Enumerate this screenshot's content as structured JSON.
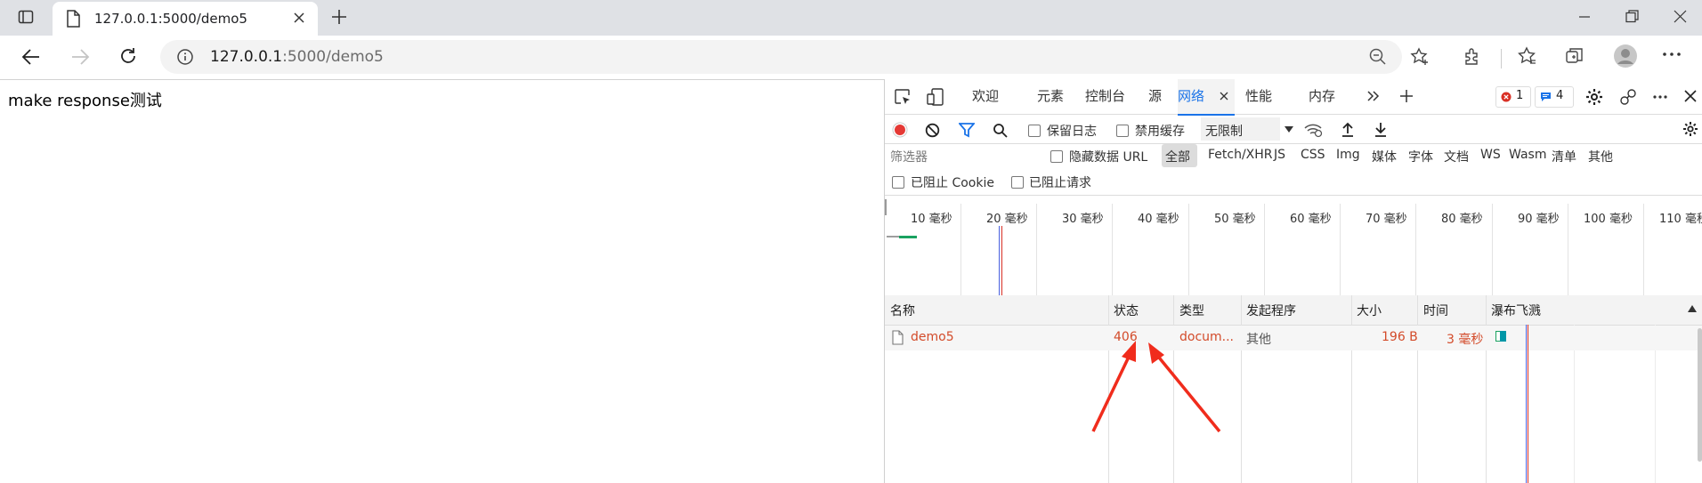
{
  "browser": {
    "tab_title": "127.0.0.1:5000/demo5",
    "url_host": "127.0.0.1",
    "url_path": ":5000/demo5"
  },
  "page": {
    "text": "make response测试"
  },
  "devtools": {
    "tabs": [
      "欢迎",
      "元素",
      "控制台",
      "源",
      "网络",
      "性能",
      "内存"
    ],
    "active_tab": "网络",
    "error_count": "1",
    "message_count": "4",
    "toolbar": {
      "preserve_log": "保留日志",
      "disable_cache": "禁用缓存",
      "throttle": "无限制"
    },
    "filter": {
      "placeholder": "筛选器",
      "hide_data_url": "隐藏数据 URL",
      "types": [
        "全部",
        "Fetch/XHR",
        "JS",
        "CSS",
        "Img",
        "媒体",
        "字体",
        "文档",
        "WS",
        "Wasm",
        "清单",
        "其他"
      ],
      "blocked_cookies": "已阻止 Cookie",
      "blocked_requests": "已阻止请求"
    },
    "timeline_ticks": [
      "10 毫秒",
      "20 毫秒",
      "30 毫秒",
      "40 毫秒",
      "50 毫秒",
      "60 毫秒",
      "70 毫秒",
      "80 毫秒",
      "90 毫秒",
      "100 毫秒",
      "110 毫秒"
    ],
    "columns": {
      "name": "名称",
      "status": "状态",
      "type": "类型",
      "initiator": "发起程序",
      "size": "大小",
      "time": "时间",
      "waterfall": "瀑布飞溅"
    },
    "requests": [
      {
        "name": "demo5",
        "status": "406",
        "type": "docum...",
        "initiator": "其他",
        "size": "196 B",
        "time": "3 毫秒"
      }
    ]
  },
  "colors": {
    "accent": "#1a73e8",
    "error": "#d34b2a",
    "record": "#e53935",
    "arrow": "#f02c1c"
  }
}
